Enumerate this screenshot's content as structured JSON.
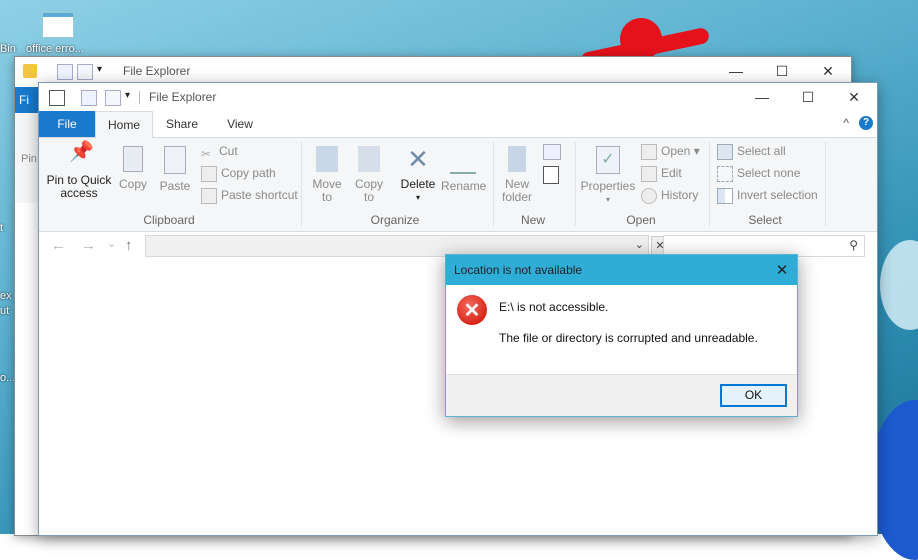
{
  "desktop": {
    "icon_labels": [
      "Bin",
      "office erro...",
      "Pin",
      "t",
      "ex",
      "ut",
      "o..."
    ]
  },
  "back_window": {
    "title": "File Explorer",
    "file_tab": "Fi",
    "pin_text": "Pin"
  },
  "window": {
    "title": "File Explorer",
    "minimize": "—",
    "maximize": "☐",
    "close": "✕",
    "help": "?",
    "collapse": "^"
  },
  "tabs": [
    {
      "label": "File"
    },
    {
      "label": "Home"
    },
    {
      "label": "Share"
    },
    {
      "label": "View"
    }
  ],
  "ribbon": {
    "clipboard": {
      "label": "Clipboard",
      "pin": "Pin to Quick",
      "pin2": "access",
      "copy": "Copy",
      "paste": "Paste",
      "cut": "Cut",
      "copy_path": "Copy path",
      "paste_shortcut": "Paste shortcut"
    },
    "organize": {
      "label": "Organize",
      "move_to": "Move",
      "move_to2": "to",
      "copy_to": "Copy",
      "copy_to2": "to",
      "delete": "Delete",
      "rename": "Rename"
    },
    "new": {
      "label": "New",
      "new_folder": "New",
      "new_folder2": "folder"
    },
    "open": {
      "label": "Open",
      "properties": "Properties",
      "open": "Open",
      "edit": "Edit",
      "history": "History"
    },
    "select": {
      "label": "Select",
      "select_all": "Select all",
      "select_none": "Select none",
      "invert": "Invert selection"
    }
  },
  "addressbar": {
    "back": "←",
    "forward": "→",
    "recent": "⌄",
    "up": "↑",
    "path": "",
    "search_placeholder": ""
  },
  "dialog": {
    "title": "Location is not available",
    "close": "✕",
    "line1": "E:\\ is not accessible.",
    "line2": "The file or directory is corrupted and unreadable.",
    "ok": "OK"
  },
  "colors": {
    "file_tab": "#1979ca",
    "dialog_title": "#2eaed6",
    "error": "#d8261c",
    "ok_border": "#0078d7"
  }
}
